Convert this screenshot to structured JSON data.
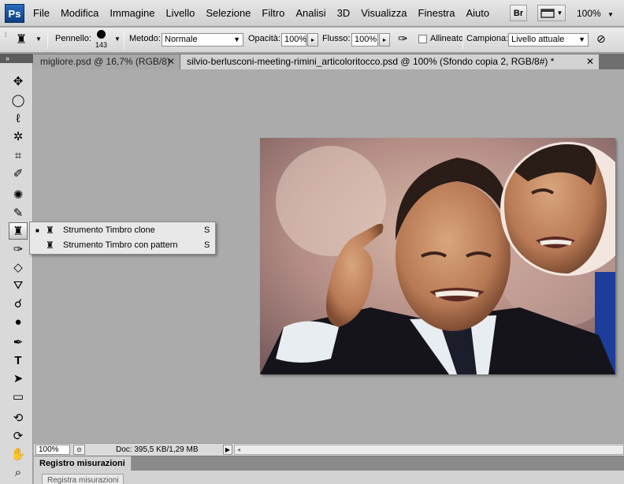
{
  "app": {
    "logo": "Ps",
    "menu": [
      "File",
      "Modifica",
      "Immagine",
      "Livello",
      "Selezione",
      "Filtro",
      "Analisi",
      "3D",
      "Visualizza",
      "Finestra",
      "Aiuto"
    ],
    "bridge_button": "Br",
    "zoom": "100%"
  },
  "options_bar": {
    "brush_label": "Pennello:",
    "brush_size": "143",
    "mode_label": "Metodo:",
    "mode_value": "Normale",
    "opacity_label": "Opacità:",
    "opacity_value": "100%",
    "flow_label": "Flusso:",
    "flow_value": "100%",
    "aligned_label": "Allineato",
    "aligned_checked": false,
    "sample_label": "Campiona:",
    "sample_value": "Livello attuale"
  },
  "tabs": [
    {
      "label": "migliore.psd @ 16,7% (RGB/8)",
      "active": false
    },
    {
      "label": "silvio-berlusconi-meeting-rimini_articoloritocco.psd @ 100% (Sfondo copia 2, RGB/8#) *",
      "active": true
    }
  ],
  "tools": {
    "panel_header": "»",
    "items": [
      {
        "name": "move",
        "icon": "move-icon",
        "glyph": "✥"
      },
      {
        "name": "marquee",
        "icon": "elliptical-marquee-icon",
        "glyph": "◯"
      },
      {
        "name": "lasso",
        "icon": "lasso-icon",
        "glyph": "ℓ"
      },
      {
        "name": "magic-wand",
        "icon": "magic-wand-icon",
        "glyph": "✲"
      },
      {
        "name": "crop",
        "icon": "crop-icon",
        "glyph": "⌗"
      },
      {
        "name": "eyedropper",
        "icon": "eyedropper-icon",
        "glyph": "✐"
      },
      {
        "name": "spot-healing",
        "icon": "spot-healing-icon",
        "glyph": "✺"
      },
      {
        "name": "brush",
        "icon": "brush-icon",
        "glyph": "✎"
      },
      {
        "name": "clone-stamp",
        "icon": "clone-stamp-icon",
        "glyph": "♜",
        "selected": true
      },
      {
        "name": "history-brush",
        "icon": "history-brush-icon",
        "glyph": "✑"
      },
      {
        "name": "eraser",
        "icon": "eraser-icon",
        "glyph": "◇"
      },
      {
        "name": "paint-bucket",
        "icon": "paint-bucket-icon",
        "glyph": "⛛"
      },
      {
        "name": "blur",
        "icon": "blur-icon",
        "glyph": "☌"
      },
      {
        "name": "dodge",
        "icon": "dodge-icon",
        "glyph": "●"
      },
      {
        "name": "pen",
        "icon": "pen-icon",
        "glyph": "✒"
      },
      {
        "name": "type",
        "icon": "type-icon",
        "glyph": "T"
      },
      {
        "name": "path-selection",
        "icon": "path-selection-icon",
        "glyph": "➤"
      },
      {
        "name": "shape",
        "icon": "rectangle-shape-icon",
        "glyph": "▭"
      },
      {
        "name": "3d-rotate",
        "icon": "3d-rotate-icon",
        "glyph": "⟲"
      },
      {
        "name": "3d-orbit",
        "icon": "3d-orbit-icon",
        "glyph": "⟳"
      },
      {
        "name": "hand",
        "icon": "hand-icon",
        "glyph": "✋"
      },
      {
        "name": "zoom",
        "icon": "zoom-icon",
        "glyph": "⌕"
      }
    ]
  },
  "flyout": [
    {
      "label": "Strumento Timbro clone",
      "shortcut": "S",
      "active": true,
      "icon": "clone-stamp-icon"
    },
    {
      "label": "Strumento Timbro con pattern",
      "shortcut": "S",
      "active": false,
      "icon": "pattern-stamp-icon"
    }
  ],
  "status_bar": {
    "zoom": "100%",
    "doc_info": "Doc: 395,5 KB/1,29 MB"
  },
  "bottom_panel": {
    "tab_label": "Registro misurazioni",
    "button_label": "Registra misurazioni"
  }
}
